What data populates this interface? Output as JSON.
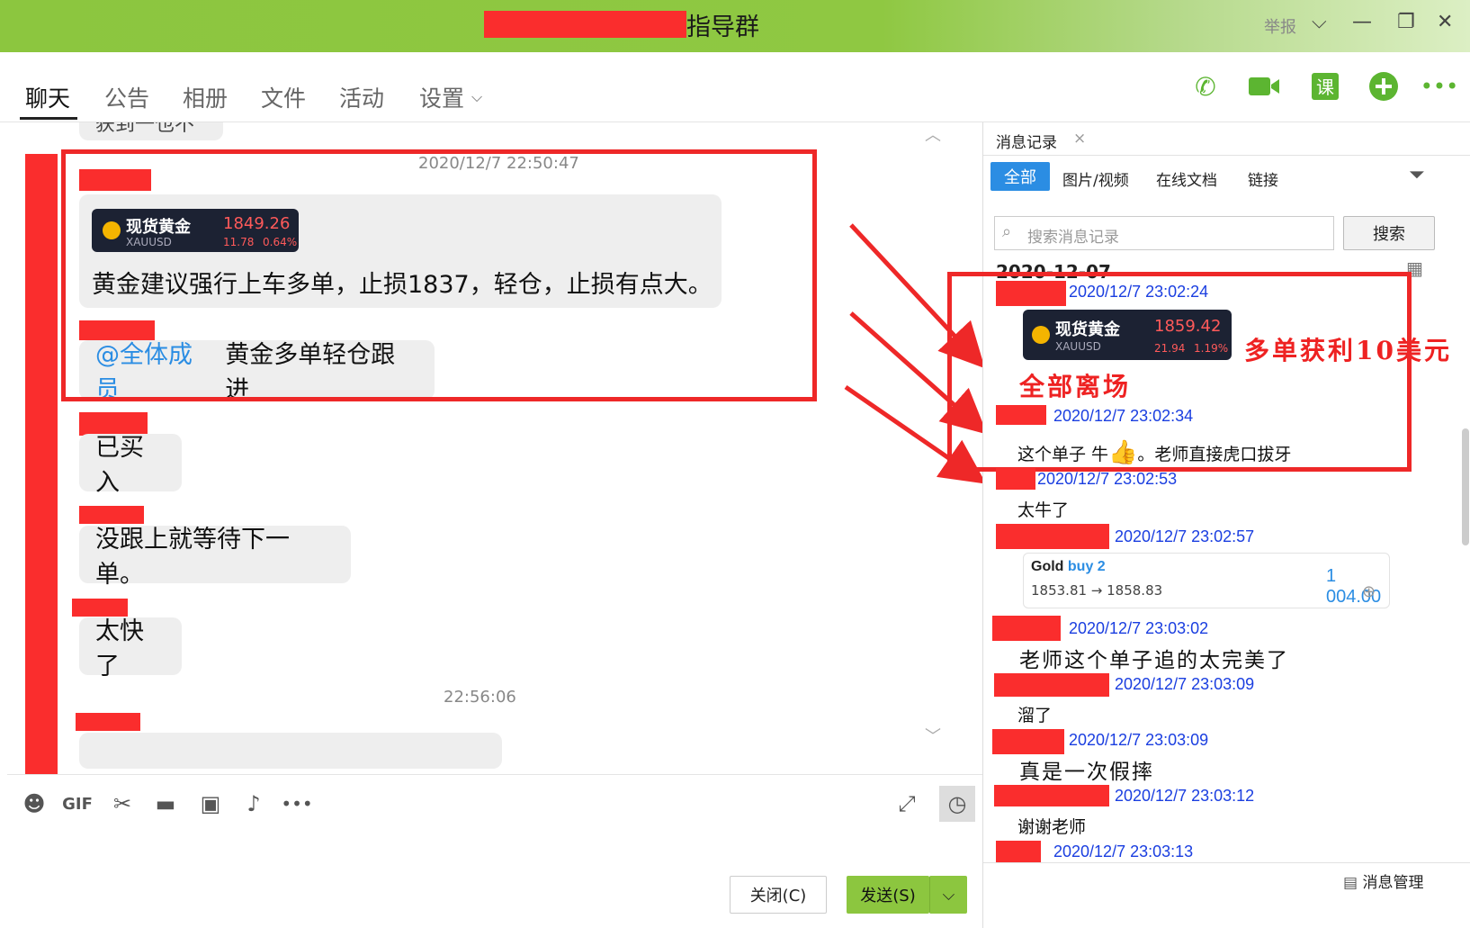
{
  "window": {
    "title": "指导群",
    "report": "举报"
  },
  "tabs": [
    "聊天",
    "公告",
    "相册",
    "文件",
    "活动",
    "设置"
  ],
  "chat": {
    "partial_top": "获到一也不",
    "ts1": "2020/12/7 22:50:47",
    "card1": {
      "name": "现货黄金",
      "symbol": "XAUUSD",
      "price": "1849.26",
      "change": "11.78",
      "pct": "0.64%"
    },
    "msg1": "黄金建议强行上车多单，止损1837，轻仓，止损有点大。",
    "msg2_mention": "@全体成员",
    "msg2_text": "黄金多单轻仓跟进",
    "msg3": "已买入",
    "msg4": "没跟上就等待下一单。",
    "msg5": "太快了",
    "ts2": "22:56:06"
  },
  "buttons": {
    "close": "关闭(C)",
    "send": "发送(S)"
  },
  "history": {
    "tab_title": "消息记录",
    "filters": [
      "全部",
      "图片/视频",
      "在线文档",
      "链接"
    ],
    "search_placeholder": "搜索消息记录",
    "search_button": "搜索",
    "date": "2020-12-07",
    "entries": [
      {
        "ts": "2020/12/7 23:02:24"
      },
      {
        "ts": "2020/12/7 23:02:34",
        "text": "这个单子 牛",
        "text2": "。老师直接虎口拔牙"
      },
      {
        "ts": "2020/12/7 23:02:53",
        "text": "太牛了"
      },
      {
        "ts": "2020/12/7 23:02:57"
      },
      {
        "ts": "2020/12/7 23:03:02",
        "text": "老师这个单子追的太完美了"
      },
      {
        "ts": "2020/12/7 23:03:09",
        "text": "溜了"
      },
      {
        "ts": "2020/12/7 23:03:09",
        "text": "真是一次假摔"
      },
      {
        "ts": "2020/12/7 23:03:12",
        "text": "谢谢老师"
      },
      {
        "ts": "2020/12/7 23:03:13"
      }
    ],
    "card2": {
      "name": "现货黄金",
      "symbol": "XAUUSD",
      "price": "1859.42",
      "change": "21.94",
      "pct": "1.19%"
    },
    "trade": {
      "label": "Gold",
      "side": "buy 2",
      "prices": "1853.81 → 1858.83",
      "profit": "1 004.00"
    },
    "annotation1": "多单获利10美元",
    "annotation2": "全部离场",
    "manage": "消息管理"
  }
}
